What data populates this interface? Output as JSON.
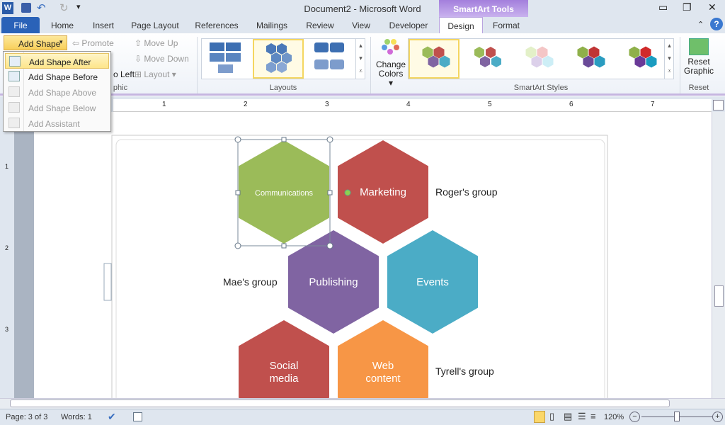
{
  "window": {
    "title": "Document2  -  Microsoft Word",
    "context_tab_group": "SmartArt Tools"
  },
  "tabs": [
    "File",
    "Home",
    "Insert",
    "Page Layout",
    "References",
    "Mailings",
    "Review",
    "View",
    "Developer",
    "Design",
    "Format"
  ],
  "ribbon": {
    "add_shape": "Add Shape",
    "promote": "Promote",
    "move_up": "Move Up",
    "move_down": "Move Down",
    "right_to_left": "o Left",
    "layout": "Layout",
    "group_create": "phic",
    "group_layouts": "Layouts",
    "change_colors": [
      "Change",
      "Colors"
    ],
    "group_styles": "SmartArt Styles",
    "reset_graphic": [
      "Reset",
      "Graphic"
    ],
    "group_reset": "Reset"
  },
  "add_shape_menu": [
    {
      "label": "Add Shape After",
      "enabled": true,
      "highlighted": true
    },
    {
      "label": "Add Shape Before",
      "enabled": true
    },
    {
      "label": "Add Shape Above",
      "enabled": false
    },
    {
      "label": "Add Shape Below",
      "enabled": false
    },
    {
      "label": "Add Assistant",
      "enabled": false
    }
  ],
  "ruler": {
    "h": [
      "1",
      "2",
      "3",
      "4",
      "5",
      "6",
      "7"
    ],
    "v": [
      "1",
      "2",
      "3"
    ]
  },
  "smartart": {
    "shapes": [
      {
        "text": [
          "Communications"
        ],
        "color": "#9BBB59",
        "selected": true
      },
      {
        "text": [
          "Marketing"
        ],
        "color": "#C0504D"
      },
      {
        "text": [
          "Publishing"
        ],
        "color": "#8064A2"
      },
      {
        "text": [
          "Events"
        ],
        "color": "#4BACC6"
      },
      {
        "text": [
          "Social",
          "media"
        ],
        "color": "#C0504D"
      },
      {
        "text": [
          "Web",
          "content"
        ],
        "color": "#F79646"
      }
    ],
    "labels": [
      "Roger's group",
      "Mae's group",
      "Tyrell's group"
    ]
  },
  "status": {
    "page": "Page: 3 of 3",
    "words": "Words: 1",
    "zoom": "120%",
    "zoom_level": 120
  }
}
